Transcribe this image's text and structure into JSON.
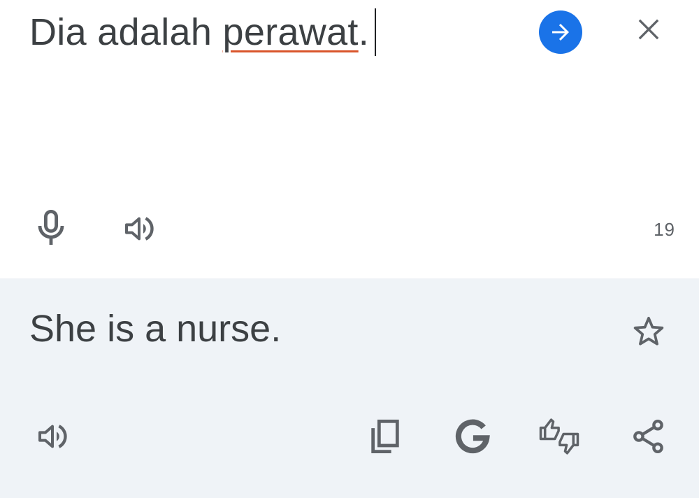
{
  "source": {
    "text_before": "Dia adalah ",
    "text_misspelled": "perawat",
    "text_after": ".",
    "char_count": "19"
  },
  "result": {
    "text": "She is a nurse."
  },
  "icons": {
    "translate": "arrow-right-icon",
    "close": "close-icon",
    "mic": "microphone-icon",
    "speak_source": "speaker-icon",
    "star": "star-outline-icon",
    "speak_result": "speaker-icon",
    "copy": "copy-icon",
    "google": "google-g-icon",
    "feedback": "thumbs-feedback-icon",
    "share": "share-icon"
  },
  "colors": {
    "accent": "#1a73e8",
    "text": "#3c4043",
    "icon": "#5f6368",
    "spellcheck_underline": "#d9552c",
    "result_background": "#eff3f7"
  }
}
